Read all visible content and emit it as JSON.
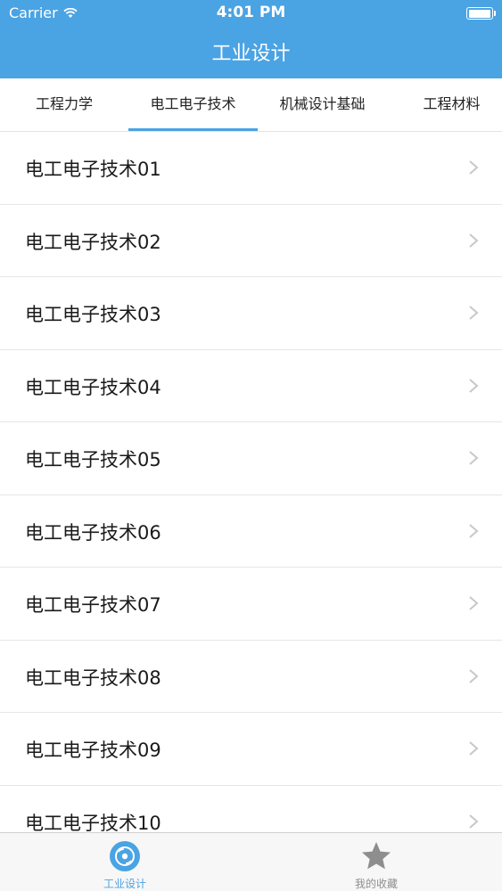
{
  "status_bar": {
    "carrier": "Carrier",
    "time": "4:01 PM"
  },
  "nav": {
    "title": "工业设计"
  },
  "tabs": [
    {
      "label": "工程力学",
      "active": false
    },
    {
      "label": "电工电子技术",
      "active": true
    },
    {
      "label": "机械设计基础",
      "active": false
    },
    {
      "label": "工程材料",
      "active": false
    }
  ],
  "list": {
    "items": [
      "电工电子技术01",
      "电工电子技术02",
      "电工电子技术03",
      "电工电子技术04",
      "电工电子技术05",
      "电工电子技术06",
      "电工电子技术07",
      "电工电子技术08",
      "电工电子技术09",
      "电工电子技术10"
    ]
  },
  "tabbar": [
    {
      "label": "工业设计",
      "icon": "disc-icon",
      "active": true
    },
    {
      "label": "我的收藏",
      "icon": "star-icon",
      "active": false
    }
  ],
  "colors": {
    "accent": "#4aa3e3",
    "inactive": "#8e8e8e"
  }
}
